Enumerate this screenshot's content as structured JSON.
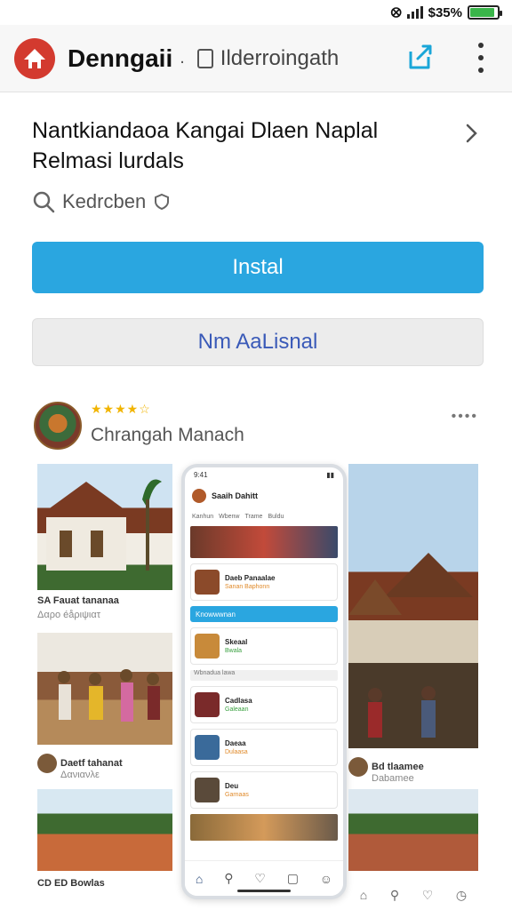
{
  "status_bar": {
    "text": "🗨 ⏱ ⸺ ¢Ω $35%",
    "battery_level": 0.9,
    "battery_color": "#3ab54a"
  },
  "app_bar": {
    "title": "Denngaii",
    "sep": ".",
    "tab_label": "Ilderroingath",
    "logo_color": "#d33a2f",
    "share_color": "#1aa6d8"
  },
  "listing": {
    "name_line1": "Nantkiandaoa Kangai Dlaen Naplal",
    "name_line2": "Relmasi lurdals",
    "meta_text": "Kedrcben"
  },
  "buttons": {
    "install": "Instal",
    "secondary": "Nm AaLisnal",
    "install_color": "#2aa6e0"
  },
  "review": {
    "stars": "★★★★☆",
    "reviewer": "Chrangah Manach",
    "more": "••••"
  },
  "gallery": {
    "left_captions": [
      {
        "title": "SA Fauat tananaa",
        "sub": "Δαρο éåριψιατ"
      },
      {
        "title": "Daetf tahanat",
        "sub": "Δανιανλε"
      },
      {
        "title": "CD ED Bowlas",
        "sub": ""
      }
    ],
    "right_captions": [
      {
        "title": "Bd tlaamee",
        "sub": "Dabamee"
      }
    ],
    "phone": {
      "status": "9:41",
      "user": "Saaih Dahitt",
      "tabs": [
        "Kanhun",
        "Wbenw",
        "Trame",
        "Buldu"
      ],
      "cards": [
        {
          "title": "Daeb Panaalae",
          "sub": "Sanan Baphonn"
        },
        {
          "title": "Skeaal",
          "sub": "Bwala"
        },
        {
          "title": "Cadlasa",
          "sub": "Galeaan"
        },
        {
          "title": "Daeaa",
          "sub": "Dulaasa"
        },
        {
          "title": "Deu",
          "sub": "Garnaas"
        }
      ],
      "blue_bar": "Knowwwnan",
      "divider": "Wbnadua lawa"
    }
  }
}
